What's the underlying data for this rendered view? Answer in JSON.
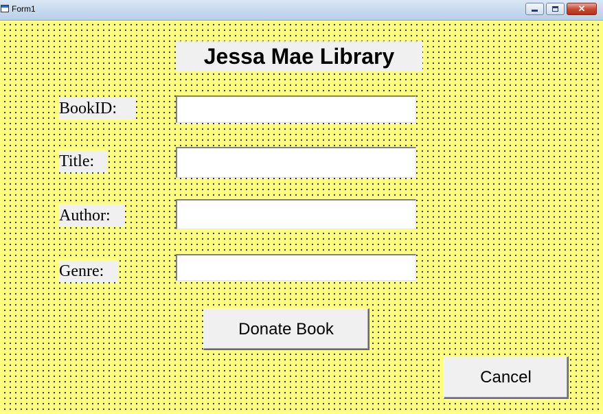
{
  "window": {
    "title": "Form1",
    "controls": {
      "minimize": "",
      "maximize": "",
      "close": "✕"
    }
  },
  "form": {
    "heading": "Jessa Mae Library",
    "fields": {
      "bookid": {
        "label": "BookID:",
        "value": ""
      },
      "title": {
        "label": "Title:",
        "value": ""
      },
      "author": {
        "label": "Author:",
        "value": ""
      },
      "genre": {
        "label": "Genre:",
        "value": ""
      }
    },
    "buttons": {
      "donate": "Donate Book",
      "cancel": "Cancel"
    }
  },
  "colors": {
    "background": "#ffff80",
    "grid_dots": "#000000",
    "label_bg": "#f0f0f0",
    "button_face": "#f0f0f0"
  },
  "icons": [
    "app-icon",
    "minimize-icon",
    "maximize-icon",
    "close-icon"
  ]
}
